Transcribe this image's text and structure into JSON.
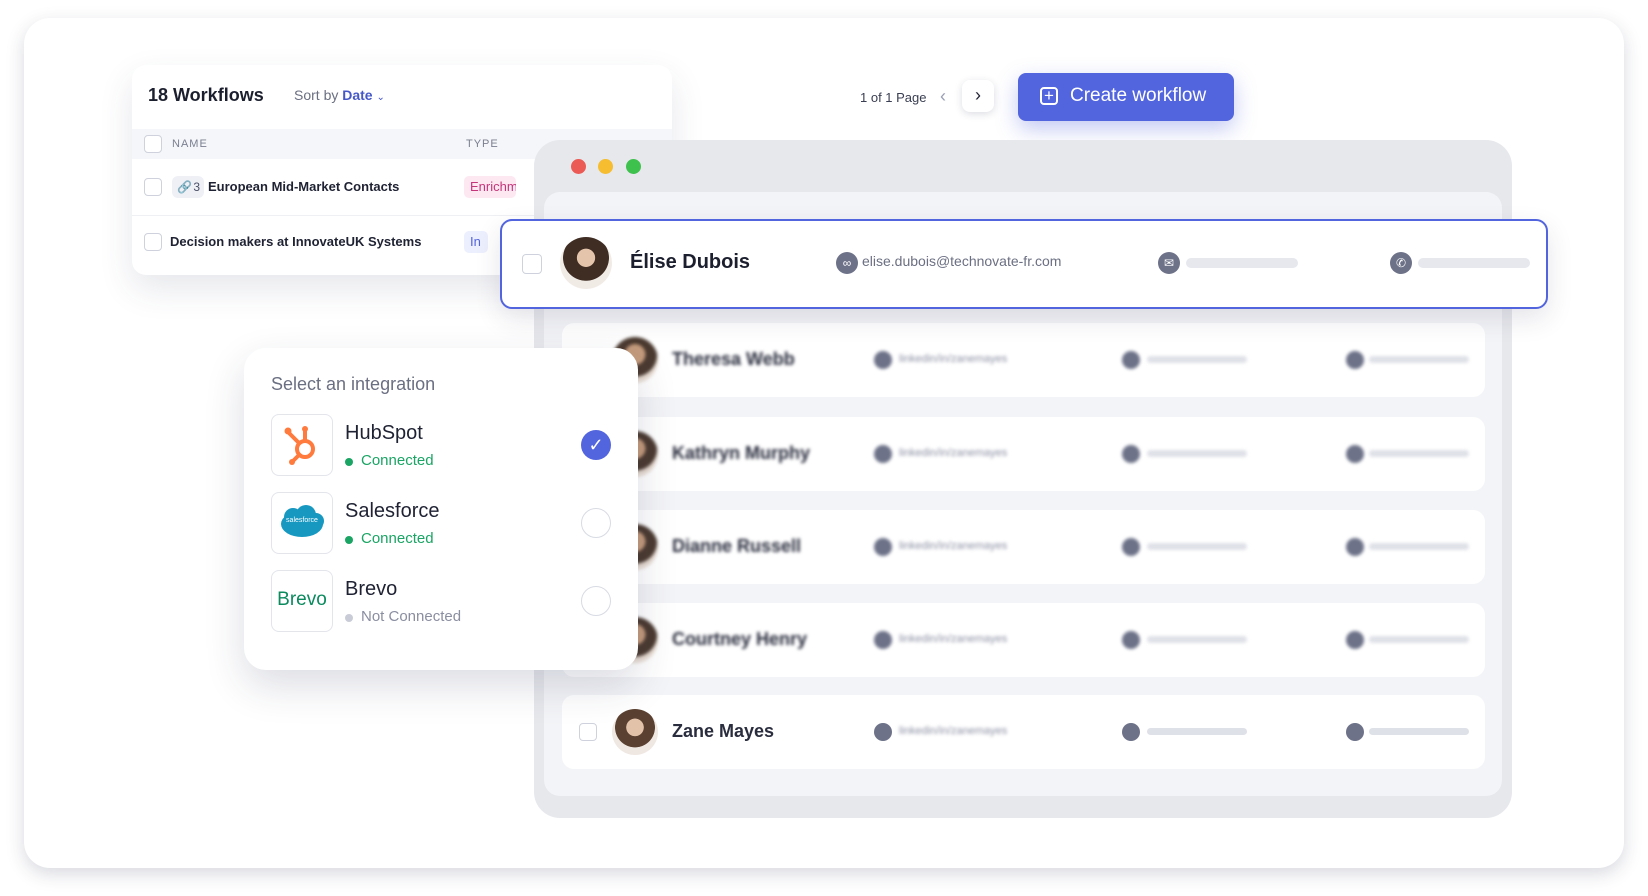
{
  "workflows": {
    "title": "18 Workflows",
    "sort_prefix": "Sort by",
    "sort_value": "Date",
    "columns": [
      "NAME",
      "TYPE"
    ],
    "rows": [
      {
        "link_count": "3",
        "name": "European Mid-Market Contacts",
        "type": "Enrichm",
        "type_color": "#c4357a",
        "type_bg": "#fde7f1"
      },
      {
        "name": "Decision makers at InnovateUK Systems",
        "type": "In",
        "type_color": "#5264de",
        "type_bg": "#eceffd"
      }
    ],
    "pagination": "1 of 1 Page",
    "create_label": "Create workflow"
  },
  "contacts": {
    "selected": {
      "name": "Élise Dubois",
      "email": "elise.dubois@technovate-fr.com"
    },
    "others": [
      {
        "name": "Theresa Webb",
        "link": "linkedin/in/zanemayes"
      },
      {
        "name": "Kathryn Murphy",
        "link": "linkedin/in/zanemayes"
      },
      {
        "name": "Dianne Russell",
        "link": "linkedin/in/zanemayes"
      },
      {
        "name": "Courtney Henry",
        "link": "linkedin/in/zanemayes"
      }
    ],
    "last": {
      "name": "Zane Mayes",
      "link": "linkedin/in/zanemayes"
    }
  },
  "integrations": {
    "heading": "Select an integration",
    "items": [
      {
        "name": "HubSpot",
        "status": "Connected",
        "selected": true,
        "status_color": "#1aa564"
      },
      {
        "name": "Salesforce",
        "status": "Connected",
        "selected": false,
        "status_color": "#1aa564",
        "logo_text": "salesforce"
      },
      {
        "name": "Brevo",
        "status": "Not Connected",
        "selected": false,
        "status_color": "#8a8ea0",
        "logo_text": "Brevo"
      }
    ]
  },
  "colors": {
    "accent": "#5264de",
    "connected": "#1aa564",
    "window_red": "#ec5a55",
    "window_yellow": "#f5bd2f",
    "window_green": "#3fc14e"
  }
}
